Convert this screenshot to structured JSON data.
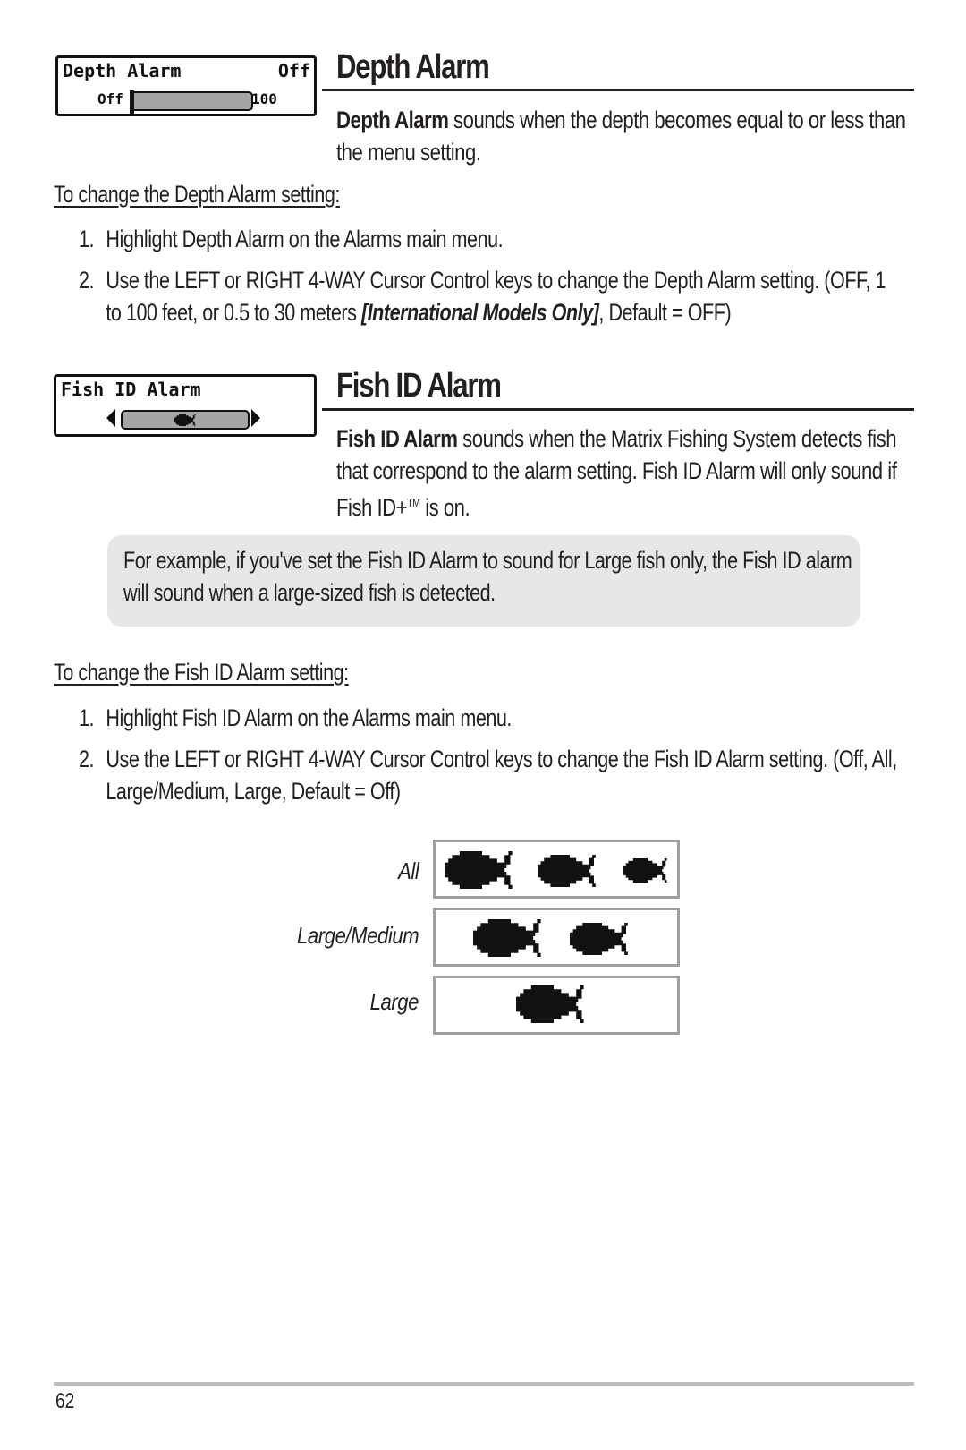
{
  "depth_alarm": {
    "lcd": {
      "title": "Depth Alarm",
      "value": "Off",
      "min_label": "Off",
      "max_label": "100",
      "slider_fraction": 0
    },
    "heading": "Depth Alarm",
    "desc_bold": "Depth Alarm",
    "desc_line1": " sounds when the depth becomes equal to or less than",
    "desc_line2": "the menu setting.",
    "procedure_title": "To change the Depth Alarm setting:",
    "steps": [
      {
        "num": "1.",
        "text": "Highlight Depth Alarm on the Alarms main menu."
      },
      {
        "num": "2.",
        "line1": "Use the LEFT or RIGHT 4-WAY Cursor Control keys to change the Depth Alarm setting. (OFF, 1",
        "line2_pre": "to 100 feet, or 0.5 to 30 meters ",
        "line2_em": "[International Models Only]",
        "line2_post": ", Default = OFF)"
      }
    ]
  },
  "fish_id_alarm": {
    "lcd": {
      "title": "Fish ID Alarm",
      "selected_icon": "fish-icon"
    },
    "heading": "Fish ID Alarm",
    "desc_bold": "Fish ID Alarm",
    "desc_line1": " sounds when the Matrix Fishing System detects fish",
    "desc_line2": "that correspond to the alarm setting. Fish ID Alarm will only sound if",
    "desc_line3_pre": "Fish ID+",
    "desc_line3_tm": "TM",
    "desc_line3_post": " is on.",
    "note_line1": "For example, if you've set the Fish ID Alarm to sound for Large fish only, the Fish ID alarm",
    "note_line2": "will sound when a large-sized fish is detected.",
    "procedure_title": "To change the Fish ID Alarm setting:",
    "steps": [
      {
        "num": "1.",
        "text": "Highlight Fish ID Alarm on the Alarms main menu."
      },
      {
        "num": "2.",
        "line1": "Use the LEFT or RIGHT 4-WAY Cursor Control keys to change the Fish ID Alarm setting. (Off, All,",
        "line2": "Large/Medium, Large, Default = Off)"
      }
    ],
    "settings_figure": [
      {
        "label": "All",
        "fish_sizes": [
          "large",
          "medium",
          "small"
        ]
      },
      {
        "label": "Large/Medium",
        "fish_sizes": [
          "large",
          "medium"
        ]
      },
      {
        "label": "Large",
        "fish_sizes": [
          "large"
        ]
      }
    ]
  },
  "footer": {
    "page_number": "62"
  }
}
